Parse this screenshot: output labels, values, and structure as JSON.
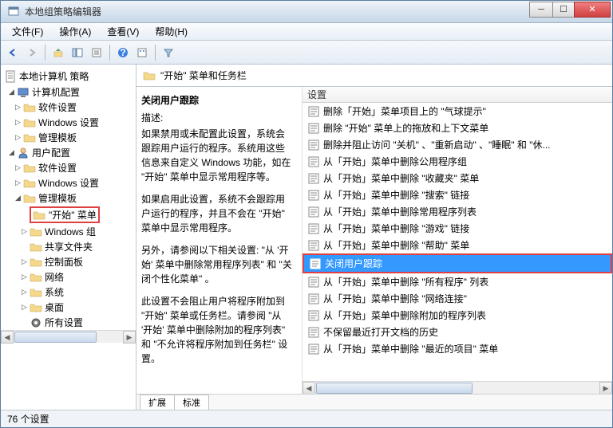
{
  "window": {
    "title": "本地组策略编辑器"
  },
  "menus": {
    "file": "文件(F)",
    "action": "操作(A)",
    "view": "查看(V)",
    "help": "帮助(H)"
  },
  "tree": {
    "root": "本地计算机 策略",
    "computer": {
      "label": "计算机配置",
      "soft": "软件设置",
      "win": "Windows 设置",
      "admin": "管理模板"
    },
    "user": {
      "label": "用户配置",
      "soft": "软件设置",
      "win": "Windows 设置",
      "admin": "管理模板",
      "start": "\"开始\" 菜单",
      "wincomp": "Windows 组",
      "shared": "共享文件夹",
      "control": "控制面板",
      "network": "网络",
      "system": "系统",
      "desktop": "桌面",
      "allset": "所有设置"
    }
  },
  "path": {
    "label": "\"开始\" 菜单和任务栏"
  },
  "desc": {
    "title": "关闭用户跟踪",
    "sub": "描述:",
    "p1": "如果禁用或未配置此设置，系统会跟踪用户运行的程序。系统用这些信息来自定义 Windows 功能，如在 \"开始\" 菜单中显示常用程序等。",
    "p2": "如果启用此设置，系统不会跟踪用户运行的程序，并且不会在 \"开始\" 菜单中显示常用程序。",
    "p3": "另外，请参阅以下相关设置: \"从 '开始' 菜单中删除常用程序列表\" 和 \"关闭个性化菜单\" 。",
    "p4": "此设置不会阻止用户将程序附加到 \"开始\" 菜单或任务栏。请参阅 \"从 '开始' 菜单中删除附加的程序列表\" 和 \"不允许将程序附加到任务栏\" 设置。"
  },
  "list": {
    "header": "设置",
    "items": [
      "删除「开始」菜单项目上的 \"气球提示\"",
      "删除 \"开始\" 菜单上的拖放和上下文菜单",
      "删除并阻止访问 \"关机\" 、\"重新启动\" 、\"睡眠\" 和 \"休...",
      "从「开始」菜单中删除公用程序组",
      "从「开始」菜单中删除 \"收藏夹\" 菜单",
      "从「开始」菜单中删除 \"搜索\" 链接",
      "从「开始」菜单中删除常用程序列表",
      "从「开始」菜单中删除 \"游戏\" 链接",
      "从「开始」菜单中删除 \"帮助\" 菜单",
      "关闭用户跟踪",
      "从「开始」菜单中删除 \"所有程序\" 列表",
      "从「开始」菜单中删除 \"网络连接\"",
      "从「开始」菜单中删除附加的程序列表",
      "不保留最近打开文档的历史",
      "从「开始」菜单中删除 \"最近的项目\" 菜单"
    ],
    "selected_index": 9
  },
  "tabs": {
    "extend": "扩展",
    "standard": "标准"
  },
  "status": "76 个设置"
}
